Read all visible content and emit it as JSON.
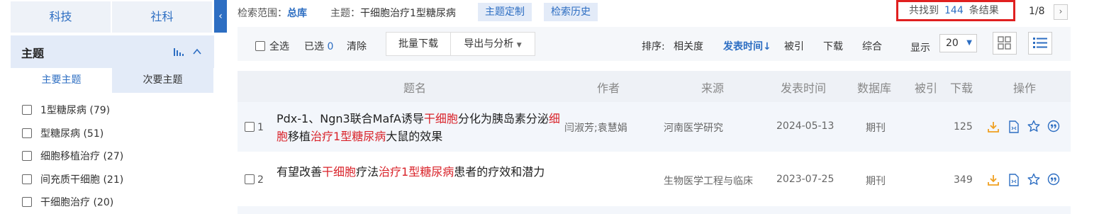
{
  "sidebar": {
    "category_tabs": [
      "科技",
      "社科"
    ],
    "facet_title": "主题",
    "subtabs": [
      "主要主题",
      "次要主题"
    ],
    "items": [
      {
        "label": "1型糖尿病",
        "count": "(79)"
      },
      {
        "label": "型糖尿病",
        "count": "(51)"
      },
      {
        "label": "细胞移植治疗",
        "count": "(27)"
      },
      {
        "label": "间充质干细胞",
        "count": "(21)"
      },
      {
        "label": "干细胞治疗",
        "count": "(20)"
      }
    ],
    "collapse_glyph": "‹"
  },
  "search_info": {
    "scope_label": "检索范围：",
    "scope_value": "总库",
    "topic_label": "主题：",
    "topic_value": "干细胞治疗1型糖尿病",
    "customize_label": "主题定制",
    "history_label": "检索历史",
    "result_prefix": "共找到",
    "result_count": "144",
    "result_suffix": "条结果",
    "page_indicator": "1/8",
    "next_glyph": "›"
  },
  "toolbar": {
    "select_all": "全选",
    "selected_label": "已选",
    "selected_count": "0",
    "clear": "清除",
    "batch_download": "批量下载",
    "export_analyze": "导出与分析",
    "sort_label": "排序:",
    "sort_options": [
      "相关度",
      "发表时间",
      "被引",
      "下载",
      "综合"
    ],
    "sort_active_arrow": "↓",
    "display_label": "显示",
    "page_size": "20"
  },
  "table": {
    "headers": [
      "题名",
      "作者",
      "来源",
      "发表时间",
      "数据库",
      "被引",
      "下载",
      "操作"
    ],
    "rows": [
      {
        "num": "1",
        "title_parts": [
          {
            "t": "Pdx-1、Ngn3联合MafA诱导",
            "hl": false
          },
          {
            "t": "干细胞",
            "hl": true
          },
          {
            "t": "分化为胰岛素分泌",
            "hl": false
          },
          {
            "t": "细胞",
            "hl": true
          },
          {
            "t": "移植",
            "hl": false
          },
          {
            "t": "治疗1型糖尿病",
            "hl": true
          },
          {
            "t": "大鼠的效果",
            "hl": false
          }
        ],
        "author": "闫淑芳;袁慧娟",
        "source": "河南医学研究",
        "date": "2024-05-13",
        "database": "期刊",
        "cited": "",
        "downloads": "125"
      },
      {
        "num": "2",
        "title_parts": [
          {
            "t": "有望改善",
            "hl": false
          },
          {
            "t": "干细胞",
            "hl": true
          },
          {
            "t": "疗法",
            "hl": false
          },
          {
            "t": "治疗1型糖尿病",
            "hl": true
          },
          {
            "t": "患者的疗效和潜力",
            "hl": false
          }
        ],
        "author": "",
        "source": "生物医学工程与临床",
        "date": "2023-07-25",
        "database": "期刊",
        "cited": "",
        "downloads": "349"
      }
    ],
    "action_icons": [
      "download-icon",
      "html-read-icon",
      "favorite-star-icon",
      "quote-icon"
    ]
  },
  "colors": {
    "accent": "#2d6ec2",
    "highlight": "#d9232a",
    "result_box_border": "#e02020",
    "download_icon": "#f0a020"
  }
}
